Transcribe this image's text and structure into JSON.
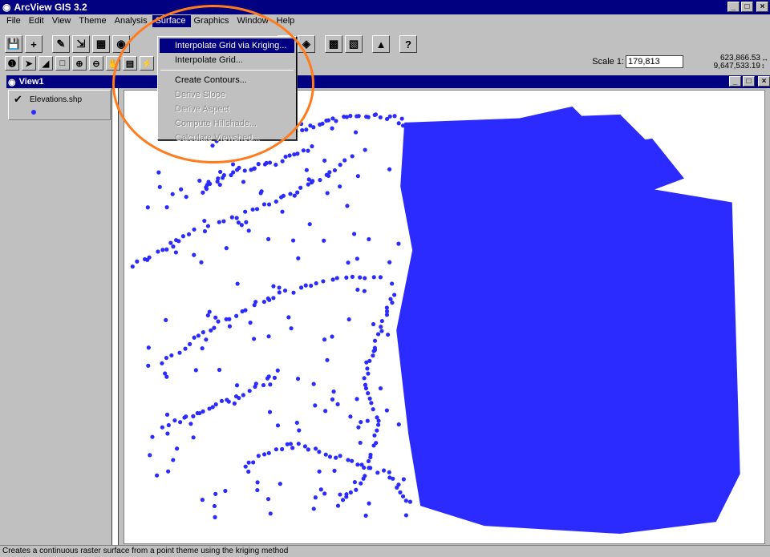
{
  "app": {
    "title": "ArcView GIS 3.2"
  },
  "menubar": [
    {
      "label": "File"
    },
    {
      "label": "Edit"
    },
    {
      "label": "View"
    },
    {
      "label": "Theme"
    },
    {
      "label": "Analysis"
    },
    {
      "label": "Surface"
    },
    {
      "label": "Graphics"
    },
    {
      "label": "Window"
    },
    {
      "label": "Help"
    }
  ],
  "surface_menu": {
    "items": [
      {
        "label": "Interpolate Grid via Kriging...",
        "state": "highlighted"
      },
      {
        "label": "Interpolate Grid...",
        "state": "enabled"
      },
      {
        "label": "Create Contours...",
        "state": "enabled"
      },
      {
        "label": "Derive Slope",
        "state": "disabled"
      },
      {
        "label": "Derive Aspect",
        "state": "disabled"
      },
      {
        "label": "Compute Hillshade...",
        "state": "disabled"
      },
      {
        "label": "Calculate Viewshed...",
        "state": "disabled"
      }
    ]
  },
  "toolbar": {
    "scale_label": "Scale 1:",
    "scale_value": "179,813",
    "coord_x": "623,866.53",
    "coord_y": "9,647,533.19"
  },
  "view": {
    "title": "View1",
    "layers": [
      {
        "name": "Elevations.shp",
        "visible": true,
        "symbol_color": "#2b2bff"
      }
    ]
  },
  "status": {
    "text": "Creates a continuous raster surface from a point theme using the kriging method"
  },
  "colors": {
    "points": "#2b2bff",
    "highlight_ring": "#ff7b1c",
    "titlebar": "#000080"
  }
}
